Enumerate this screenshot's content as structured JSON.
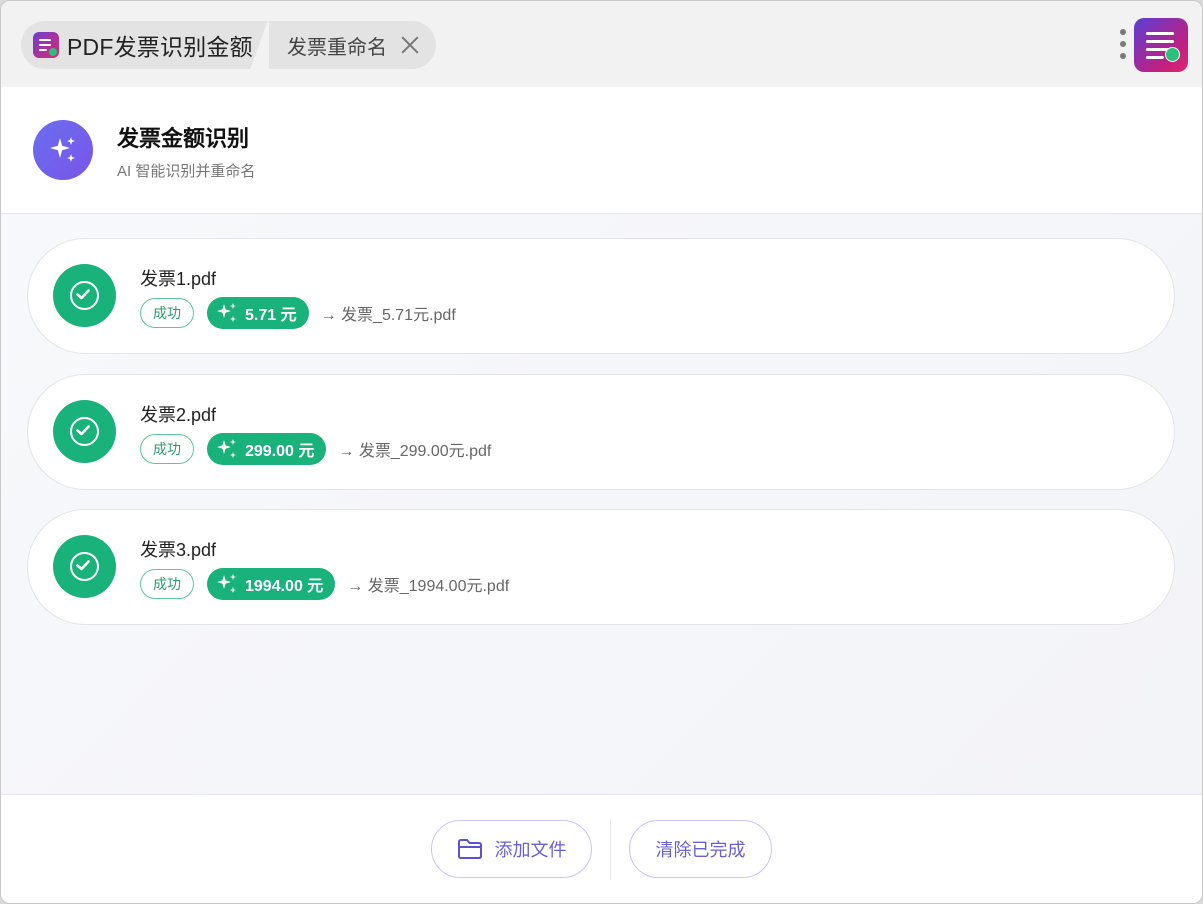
{
  "window": {
    "tabs": [
      {
        "label": "PDF发票识别金额",
        "icon": "app-logo-icon"
      },
      {
        "label": "发票重命名",
        "icon": "close-icon"
      }
    ],
    "menu_icon": "more-vertical-icon",
    "corner_icon": "app-logo-icon"
  },
  "header": {
    "title": "发票金额识别",
    "subtitle": "AI 智能识别并重命名",
    "icon": "sparkle-icon"
  },
  "files": [
    {
      "name": "发票1.pdf",
      "status": "成功",
      "amount": "5.71 元",
      "new_name": "→ 发票_5.71元.pdf"
    },
    {
      "name": "发票2.pdf",
      "status": "成功",
      "amount": "299.00 元",
      "new_name": "→ 发票_299.00元.pdf"
    },
    {
      "name": "发票3.pdf",
      "status": "成功",
      "amount": "1994.00 元",
      "new_name": "→ 发票_1994.00元.pdf"
    }
  ],
  "footer": {
    "add_label": "添加文件",
    "clear_label": "清除已完成"
  },
  "colors": {
    "success": "#19b27b",
    "accent": "#6a5fd9",
    "brand_start": "#5a3fd6",
    "brand_end": "#e0266e"
  }
}
